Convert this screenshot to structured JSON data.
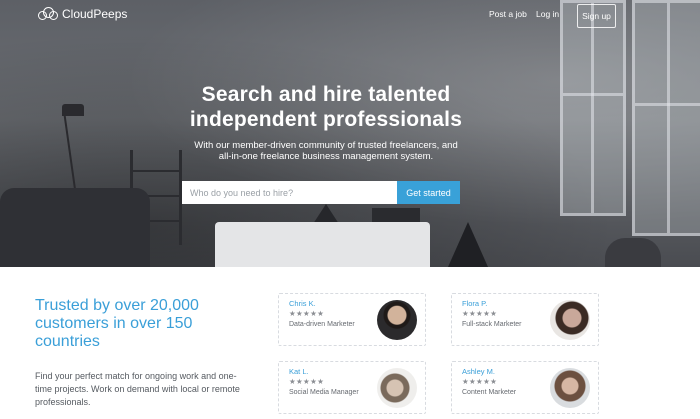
{
  "brand": {
    "name": "CloudPeeps",
    "icon": "cloud-logo-icon"
  },
  "nav": {
    "post_job": "Post a job",
    "login": "Log in",
    "signup": "Sign up"
  },
  "hero": {
    "title_line1": "Search and hire talented",
    "title_line2": "independent professionals",
    "subtitle_line1": "With our member-driven community of trusted freelancers, and",
    "subtitle_line2": "all-in-one freelance business management system.",
    "search_placeholder": "Who do you need to hire?",
    "search_button": "Get started"
  },
  "trusted": {
    "heading": "Trusted by over 20,000 customers in over 150 countries",
    "blurb": "Find your perfect match for ongoing work and one-time projects. Work on demand with local or remote professionals."
  },
  "profiles": [
    {
      "name": "Chris K.",
      "stars": "★★★★★",
      "role": "Data-driven Marketer"
    },
    {
      "name": "Flora P.",
      "stars": "★★★★★",
      "role": "Full-stack Marketer"
    },
    {
      "name": "Kat L.",
      "stars": "★★★★★",
      "role": "Social Media Manager"
    },
    {
      "name": "Ashley M.",
      "stars": "★★★★★",
      "role": "Content Marketer"
    }
  ],
  "colors": {
    "accent": "#3a9fd8",
    "button": "#39a1d8",
    "hero_overlay": "#5d6066"
  }
}
